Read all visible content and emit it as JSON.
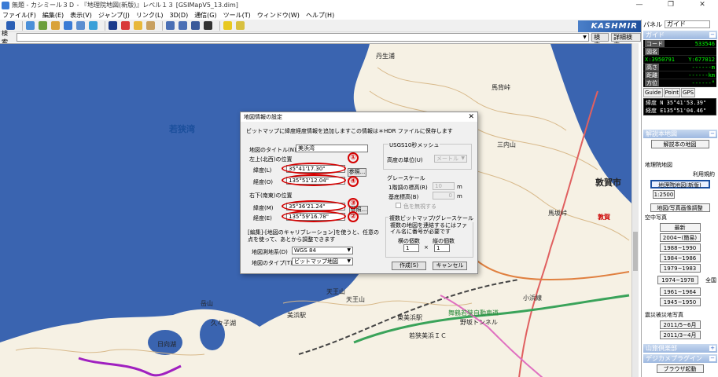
{
  "window": {
    "title": "無題 - カシミール３Ｄ - 『地理院地図(新版)』レベル１３ [GSIMapV5_13.dim]",
    "controls": [
      "—",
      "❐",
      "✕"
    ]
  },
  "menu": [
    "ファイル(F)",
    "編集(E)",
    "表示(V)",
    "ジャンプ(J)",
    "リンク(L)",
    "3D(D)",
    "通信(G)",
    "ツール(T)",
    "ウィンドウ(W)",
    "ヘルプ(H)"
  ],
  "brand": "KASHMIR 3D",
  "search": {
    "label": "検索",
    "value": "",
    "search_button": "検索",
    "detail_button": "詳細検索"
  },
  "panel": {
    "label": "パネル",
    "select": "ガイド",
    "guide_title": "ガイド",
    "guide_rows": [
      {
        "label": "コード",
        "value": "533546"
      },
      {
        "label": "図名",
        "value": ""
      },
      {
        "label": "X:3950791",
        "value": "Y:677012"
      },
      {
        "label": "高さ",
        "value": "------m"
      },
      {
        "label": "距離",
        "value": "------km"
      },
      {
        "label": "方位",
        "value": "------°"
      }
    ],
    "guide_buttons": [
      "Guide",
      "Point",
      "GPS"
    ],
    "lat": "緯度  N 35°41'53.39\"",
    "lon": "経度  E135°51'04.46\"",
    "kaisetsu_title": "解説本地図",
    "kaisetsu_btn": "解説本の地図",
    "chiriin_label": "地理院地図",
    "riyou": "利用規約",
    "chiriin_btn": "地理院地図(新版)",
    "scale_btn": "1:2500",
    "adjust_btn": "地図/写真画像調整",
    "aerial_label": "空中写真",
    "aerial": [
      "最新",
      "2004~(簡易)",
      "1988~1990",
      "1984~1986",
      "1979~1983",
      "1974~1978",
      "1961~1964",
      "1945~1950"
    ],
    "all_label": "全国",
    "quake_label": "震災被災地写真",
    "quake": [
      "2011/5~6月",
      "2011/3~4月"
    ],
    "kaiko_title": "山旅倶楽部",
    "dejikame_title": "デジカメプラグイン",
    "browse_btn": "ブラウザ起動"
  },
  "dialog": {
    "title": "地図情報の設定",
    "description": "ビットマップに緯度経度情報を追加しますこの情報は＊HDR ファイルに保存します",
    "map_title_label": "地図のタイトル(N)",
    "map_title_value": "美浜湾",
    "upper_left_label": "左上(北西)の位置",
    "lower_right_label": "右下(南東)の位置",
    "lat_label": "緯度(L)",
    "lon_label": "経度(O)",
    "lat2_label": "緯度(M)",
    "lon2_label": "経度(E)",
    "ul_lat": "35°41'17.30\"",
    "ul_lon": "135°51'12.04\"",
    "lr_lat": "35°36'21.24\"",
    "lr_lon": "135°59'16.78\"",
    "ref_button": "参照...",
    "note": "[編集]-[地図のキャリブレーション]を使うと、任意の点を使って、あとから調整できます",
    "datum_label": "地図測地系(D)",
    "datum_value": "WGS 84",
    "type_label": "地図のタイプ(T)",
    "type_value": "ビットマップ地図",
    "usgs_label": "USGS10秒メッシュ",
    "height_unit_label": "高度の単位(U)",
    "height_unit_value": "メートル",
    "gray_label": "グレースケール",
    "step_label": "1階調の標高(R)",
    "step_value": "10",
    "base_label": "基底標高(B)",
    "base_value": "0",
    "unit_m": "m",
    "ignore_color_label": "色を無視する",
    "multi_label": "複数ビットマップ/グレースケール",
    "multi_desc": "複数の地図を連結するにはファイル名に番号が必要です",
    "h_count_label": "横の個数",
    "v_count_label": "縦の個数",
    "h_count": "1",
    "v_count": "1",
    "times": "×",
    "create_button": "作成(S)",
    "cancel_button": "キャンセル",
    "annotations": [
      "①",
      "④",
      "③",
      "②"
    ]
  },
  "map_labels": {
    "wakasa_bay": "若狭湾",
    "tsuruga_city": "敦賀市",
    "tsuruga": "敦賀",
    "mihama_station": "美浜駅",
    "higashimihama": "東美浜駅",
    "maiwaka": "舞鶴若狭自動車道",
    "nosaka_tunnel": "野坂トンネル",
    "mihama_ic": "若狭美浜ＩＣ",
    "tenno": "天王山",
    "mt_dake": "岳山",
    "umamukai": "馬背峠",
    "kuzuka": "久々子湖",
    "hiruga": "日向湖",
    "umakaeri": "馬坂峠",
    "sanzaku": "三内山",
    "kamisuke": "天王山",
    "noto": "小浜線",
    "kushiro": "丹生浦"
  },
  "colors": {
    "sea": "#3a64b0",
    "land": "#f6f1e4",
    "road_green": "#3aa35a",
    "road_purple": "#a020c0"
  }
}
